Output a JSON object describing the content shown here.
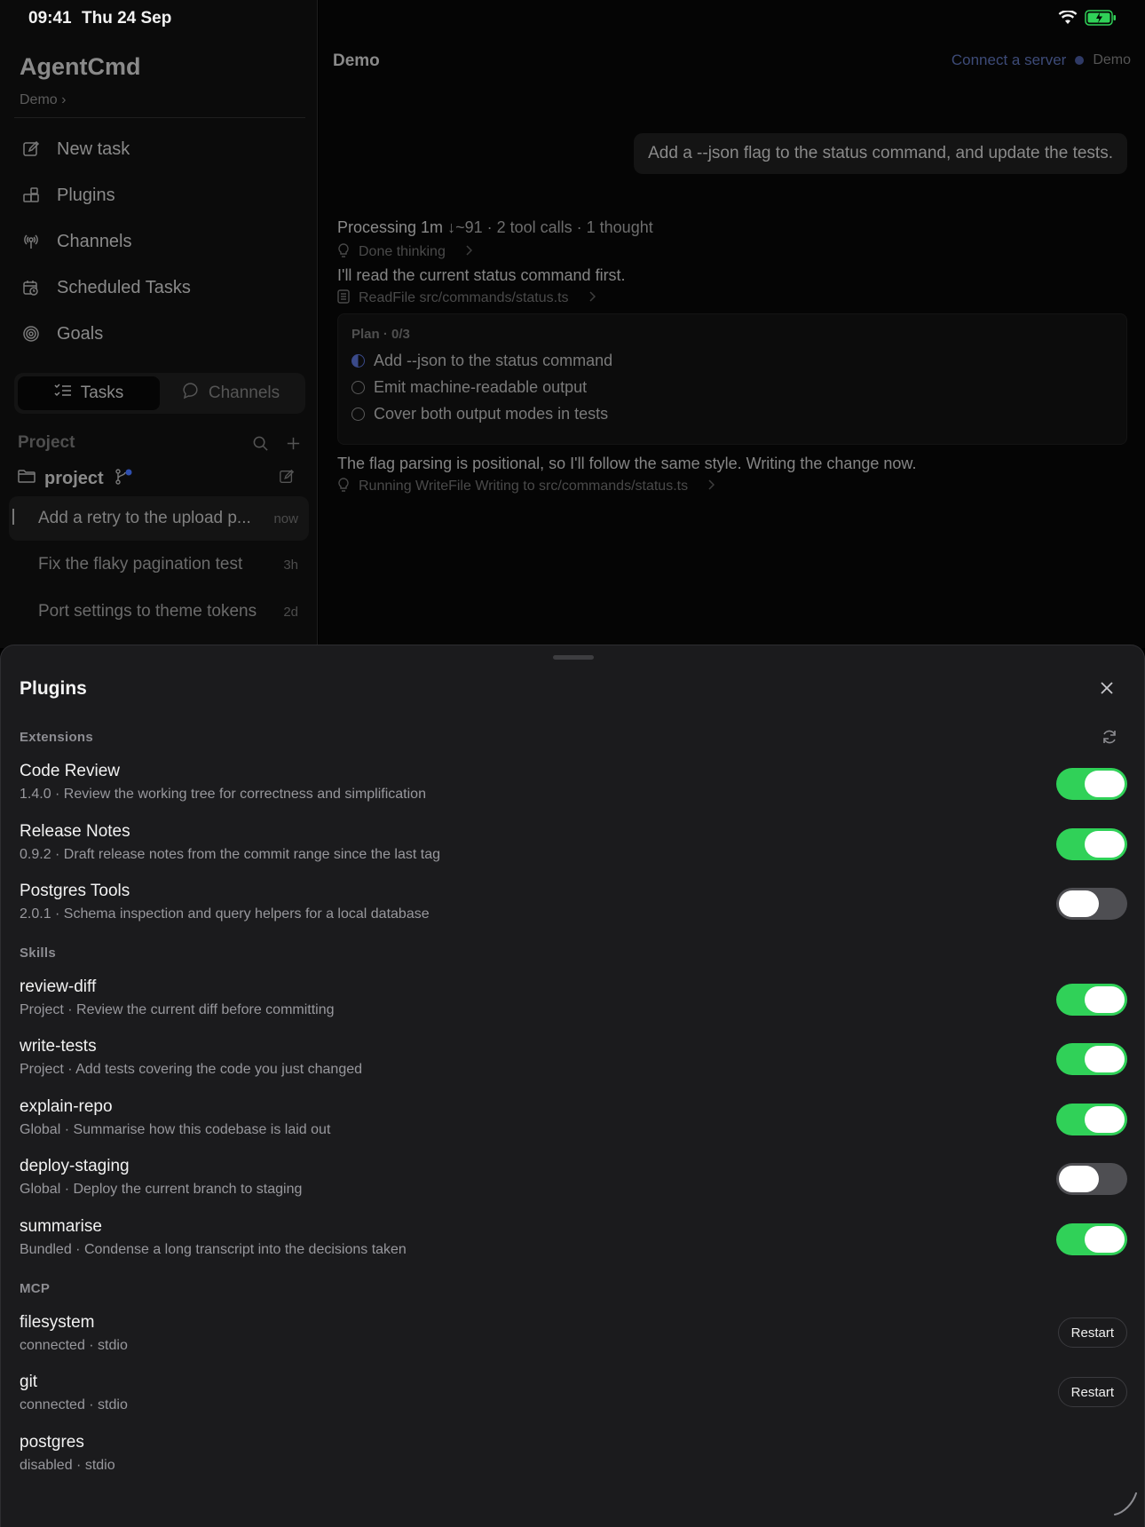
{
  "status_bar": {
    "time": "09:41",
    "date": "Thu 24 Sep"
  },
  "sidebar": {
    "brand": "AgentCmd",
    "workspace": "Demo ›",
    "nav": [
      {
        "label": "New task",
        "icon": "compose-icon"
      },
      {
        "label": "Plugins",
        "icon": "puzzle-icon"
      },
      {
        "label": "Channels",
        "icon": "broadcast-icon"
      },
      {
        "label": "Scheduled Tasks",
        "icon": "calendar-clock-icon"
      },
      {
        "label": "Goals",
        "icon": "target-icon"
      }
    ],
    "segment": {
      "tasks": "Tasks",
      "channels": "Channels",
      "selected": "Tasks"
    },
    "project_header": "Project",
    "project_name": "project",
    "tasks": [
      {
        "title": "Add a retry to the upload p...",
        "time": "now"
      },
      {
        "title": "Fix the flaky pagination test",
        "time": "3h"
      },
      {
        "title": "Port settings to theme tokens",
        "time": "2d"
      }
    ]
  },
  "main": {
    "title": "Demo",
    "connect_label": "Connect a server",
    "demo_badge": "Demo",
    "user_message": "Add a --json flag to the status command, and update the tests.",
    "processing_label": "Processing 1m",
    "processing_stats": "↓~91 · 2 tool calls · 1 thought",
    "thinking": "Done thinking",
    "assistant_1": "I'll read the current status command first.",
    "tool_1": "ReadFile src/commands/status.ts",
    "plan": {
      "title": "Plan · 0/3",
      "items": [
        {
          "label": "Add --json to the status command",
          "state": "in-progress"
        },
        {
          "label": "Emit machine-readable output",
          "state": "pending"
        },
        {
          "label": "Cover both output modes in tests",
          "state": "pending"
        }
      ]
    },
    "assistant_2": "The flag parsing is positional, so I'll follow the same style. Writing the change now.",
    "tool_2": "Running WriteFile Writing to src/commands/status.ts"
  },
  "plugins_sheet": {
    "title": "Plugins",
    "extensions_label": "Extensions",
    "extensions": [
      {
        "name": "Code Review",
        "desc": "1.4.0 · Review the working tree for correctness and simplification",
        "enabled": true
      },
      {
        "name": "Release Notes",
        "desc": "0.9.2 · Draft release notes from the commit range since the last tag",
        "enabled": true
      },
      {
        "name": "Postgres Tools",
        "desc": "2.0.1 · Schema inspection and query helpers for a local database",
        "enabled": false
      }
    ],
    "skills_label": "Skills",
    "skills": [
      {
        "name": "review-diff",
        "desc": "Project · Review the current diff before committing",
        "enabled": true
      },
      {
        "name": "write-tests",
        "desc": "Project · Add tests covering the code you just changed",
        "enabled": true
      },
      {
        "name": "explain-repo",
        "desc": "Global · Summarise how this codebase is laid out",
        "enabled": true
      },
      {
        "name": "deploy-staging",
        "desc": "Global · Deploy the current branch to staging",
        "enabled": false
      },
      {
        "name": "summarise",
        "desc": "Bundled · Condense a long transcript into the decisions taken",
        "enabled": true
      }
    ],
    "mcp_label": "MCP",
    "mcp": [
      {
        "name": "filesystem",
        "desc": "connected · stdio",
        "action": "Restart"
      },
      {
        "name": "git",
        "desc": "connected · stdio",
        "action": "Restart"
      },
      {
        "name": "postgres",
        "desc": "disabled · stdio",
        "action": ""
      }
    ]
  },
  "colors": {
    "toggle_on": "#30d158",
    "toggle_off": "#4e4e52",
    "accent": "#4a5ed0"
  }
}
